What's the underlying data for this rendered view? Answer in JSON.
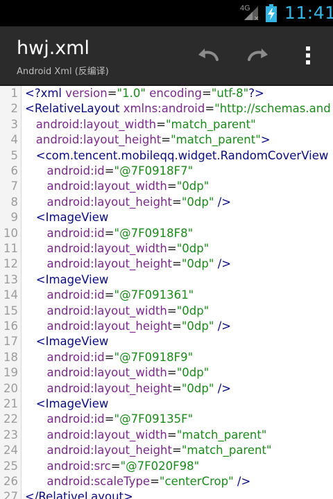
{
  "statusbar": {
    "network": "4G",
    "time": "11:41",
    "signal_icon": "signal-icon",
    "battery_icon": "battery-charging-icon"
  },
  "actionbar": {
    "title": "hwj.xml",
    "subtitle": "Android Xml (反编译)",
    "undo_icon": "undo-icon",
    "redo_icon": "redo-icon",
    "overflow_icon": "overflow-menu-icon"
  },
  "colors": {
    "status_accent": "#33b5e5",
    "tag": "#0b0b80",
    "attribute": "#7b2a8c",
    "value": "#1b8a1b"
  },
  "editor": {
    "lines": [
      {
        "n": "1",
        "tokens": [
          [
            "tag",
            "<?xml "
          ],
          [
            "attr",
            "version"
          ],
          [
            "punc",
            "="
          ],
          [
            "val",
            "\"1.0\""
          ],
          [
            "punc",
            " "
          ],
          [
            "attr",
            "encoding"
          ],
          [
            "punc",
            "="
          ],
          [
            "val",
            "\"utf-8\""
          ],
          [
            "tag",
            "?>"
          ]
        ]
      },
      {
        "n": "2",
        "tokens": [
          [
            "tag",
            "<RelativeLayout "
          ],
          [
            "attr",
            "xmlns:android"
          ],
          [
            "punc",
            "="
          ],
          [
            "val",
            "\"http://schemas.and"
          ]
        ]
      },
      {
        "n": "3",
        "tokens": [
          [
            "punc",
            "   "
          ],
          [
            "attr",
            "android:layout_width"
          ],
          [
            "punc",
            "="
          ],
          [
            "val",
            "\"match_parent\""
          ]
        ]
      },
      {
        "n": "4",
        "tokens": [
          [
            "punc",
            "   "
          ],
          [
            "attr",
            "android:layout_height"
          ],
          [
            "punc",
            "="
          ],
          [
            "val",
            "\"match_parent\""
          ],
          [
            "tag",
            ">"
          ]
        ]
      },
      {
        "n": "5",
        "tokens": [
          [
            "punc",
            "   "
          ],
          [
            "tag",
            "<com.tencent.mobileqq.widget.RandomCoverView"
          ]
        ]
      },
      {
        "n": "6",
        "tokens": [
          [
            "punc",
            "      "
          ],
          [
            "attr",
            "android:id"
          ],
          [
            "punc",
            "="
          ],
          [
            "val",
            "\"@7F0918F7\""
          ]
        ]
      },
      {
        "n": "7",
        "tokens": [
          [
            "punc",
            "      "
          ],
          [
            "attr",
            "android:layout_width"
          ],
          [
            "punc",
            "="
          ],
          [
            "val",
            "\"0dp\""
          ]
        ]
      },
      {
        "n": "8",
        "tokens": [
          [
            "punc",
            "      "
          ],
          [
            "attr",
            "android:layout_height"
          ],
          [
            "punc",
            "="
          ],
          [
            "val",
            "\"0dp\""
          ],
          [
            "tag",
            " />"
          ]
        ]
      },
      {
        "n": "9",
        "tokens": [
          [
            "punc",
            "   "
          ],
          [
            "tag",
            "<ImageView"
          ]
        ]
      },
      {
        "n": "10",
        "tokens": [
          [
            "punc",
            "      "
          ],
          [
            "attr",
            "android:id"
          ],
          [
            "punc",
            "="
          ],
          [
            "val",
            "\"@7F0918F8\""
          ]
        ]
      },
      {
        "n": "11",
        "tokens": [
          [
            "punc",
            "      "
          ],
          [
            "attr",
            "android:layout_width"
          ],
          [
            "punc",
            "="
          ],
          [
            "val",
            "\"0dp\""
          ]
        ]
      },
      {
        "n": "12",
        "tokens": [
          [
            "punc",
            "      "
          ],
          [
            "attr",
            "android:layout_height"
          ],
          [
            "punc",
            "="
          ],
          [
            "val",
            "\"0dp\""
          ],
          [
            "tag",
            " />"
          ]
        ]
      },
      {
        "n": "13",
        "tokens": [
          [
            "punc",
            "   "
          ],
          [
            "tag",
            "<ImageView"
          ]
        ]
      },
      {
        "n": "14",
        "tokens": [
          [
            "punc",
            "      "
          ],
          [
            "attr",
            "android:id"
          ],
          [
            "punc",
            "="
          ],
          [
            "val",
            "\"@7F091361\""
          ]
        ]
      },
      {
        "n": "15",
        "tokens": [
          [
            "punc",
            "      "
          ],
          [
            "attr",
            "android:layout_width"
          ],
          [
            "punc",
            "="
          ],
          [
            "val",
            "\"0dp\""
          ]
        ]
      },
      {
        "n": "16",
        "tokens": [
          [
            "punc",
            "      "
          ],
          [
            "attr",
            "android:layout_height"
          ],
          [
            "punc",
            "="
          ],
          [
            "val",
            "\"0dp\""
          ],
          [
            "tag",
            " />"
          ]
        ]
      },
      {
        "n": "17",
        "tokens": [
          [
            "punc",
            "   "
          ],
          [
            "tag",
            "<ImageView"
          ]
        ]
      },
      {
        "n": "18",
        "tokens": [
          [
            "punc",
            "      "
          ],
          [
            "attr",
            "android:id"
          ],
          [
            "punc",
            "="
          ],
          [
            "val",
            "\"@7F0918F9\""
          ]
        ]
      },
      {
        "n": "19",
        "tokens": [
          [
            "punc",
            "      "
          ],
          [
            "attr",
            "android:layout_width"
          ],
          [
            "punc",
            "="
          ],
          [
            "val",
            "\"0dp\""
          ]
        ]
      },
      {
        "n": "20",
        "tokens": [
          [
            "punc",
            "      "
          ],
          [
            "attr",
            "android:layout_height"
          ],
          [
            "punc",
            "="
          ],
          [
            "val",
            "\"0dp\""
          ],
          [
            "tag",
            " />"
          ]
        ]
      },
      {
        "n": "21",
        "tokens": [
          [
            "punc",
            "   "
          ],
          [
            "tag",
            "<ImageView"
          ]
        ]
      },
      {
        "n": "22",
        "tokens": [
          [
            "punc",
            "      "
          ],
          [
            "attr",
            "android:id"
          ],
          [
            "punc",
            "="
          ],
          [
            "val",
            "\"@7F09135F\""
          ]
        ]
      },
      {
        "n": "23",
        "tokens": [
          [
            "punc",
            "      "
          ],
          [
            "attr",
            "android:layout_width"
          ],
          [
            "punc",
            "="
          ],
          [
            "val",
            "\"match_parent\""
          ]
        ]
      },
      {
        "n": "24",
        "tokens": [
          [
            "punc",
            "      "
          ],
          [
            "attr",
            "android:layout_height"
          ],
          [
            "punc",
            "="
          ],
          [
            "val",
            "\"match_parent\""
          ]
        ]
      },
      {
        "n": "25",
        "tokens": [
          [
            "punc",
            "      "
          ],
          [
            "attr",
            "android:src"
          ],
          [
            "punc",
            "="
          ],
          [
            "val",
            "\"@7F020F98\""
          ]
        ]
      },
      {
        "n": "26",
        "tokens": [
          [
            "punc",
            "      "
          ],
          [
            "attr",
            "android:scaleType"
          ],
          [
            "punc",
            "="
          ],
          [
            "val",
            "\"centerCrop\""
          ],
          [
            "tag",
            " />"
          ]
        ]
      },
      {
        "n": "27",
        "tokens": [
          [
            "tag",
            "</RelativeLayout>"
          ]
        ]
      }
    ]
  }
}
